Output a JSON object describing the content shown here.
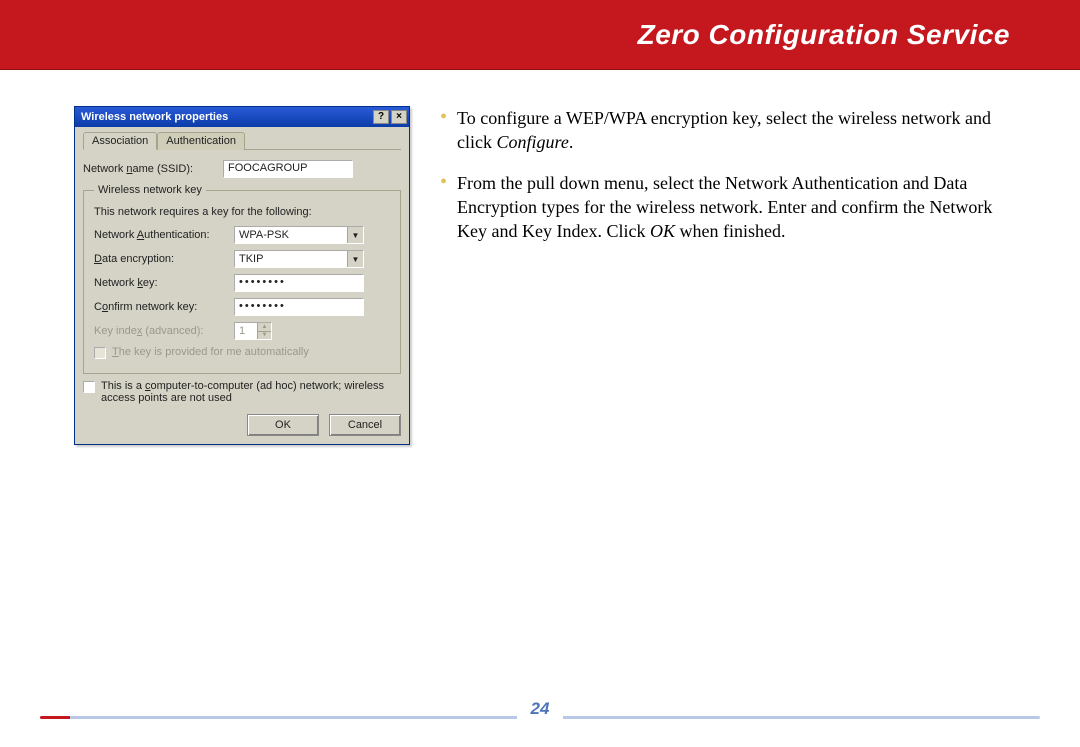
{
  "header": {
    "title": "Zero Configuration Service"
  },
  "dialog": {
    "title": "Wireless network properties",
    "help_btn": "?",
    "close_btn": "×",
    "tabs": {
      "association": "Association",
      "authentication": "Authentication"
    },
    "ssid_label_pre": "Network ",
    "ssid_label_u": "n",
    "ssid_label_post": "ame (SSID):",
    "ssid_value": "FOOCAGROUP",
    "group_legend": "Wireless network key",
    "group_hint": "This network requires a key for the following:",
    "auth_label_pre": "Network ",
    "auth_label_u": "A",
    "auth_label_post": "uthentication:",
    "auth_value": "WPA-PSK",
    "enc_label_u": "D",
    "enc_label_post": "ata encryption:",
    "enc_value": "TKIP",
    "key_label_pre": "Network ",
    "key_label_u": "k",
    "key_label_post": "ey:",
    "key_value": "••••••••",
    "confirm_label_pre": "C",
    "confirm_label_u": "o",
    "confirm_label_post": "nfirm network key:",
    "confirm_value": "••••••••",
    "keyindex_label_pre": "Key inde",
    "keyindex_label_u": "x",
    "keyindex_label_post": " (advanced):",
    "keyindex_value": "1",
    "autokey_label_u": "T",
    "autokey_label_post": "he key is provided for me automatically",
    "adhoc_label_pre": "This is a ",
    "adhoc_label_u": "c",
    "adhoc_label_post": "omputer-to-computer (ad hoc) network; wireless access points are not used",
    "ok_btn": "OK",
    "cancel_btn": "Cancel"
  },
  "instructions": {
    "items": [
      {
        "text_a": "To configure a WEP/WPA encryption key, select the wireless network and click ",
        "em": "Configure",
        "text_b": "."
      },
      {
        "text_a": "From the pull down menu, select the Network Authentication and Data Encryption types for the wireless network.  Enter and confirm the Network Key and Key Index.  Click ",
        "em": "OK",
        "text_b": " when finished."
      }
    ]
  },
  "footer": {
    "page": "24"
  }
}
